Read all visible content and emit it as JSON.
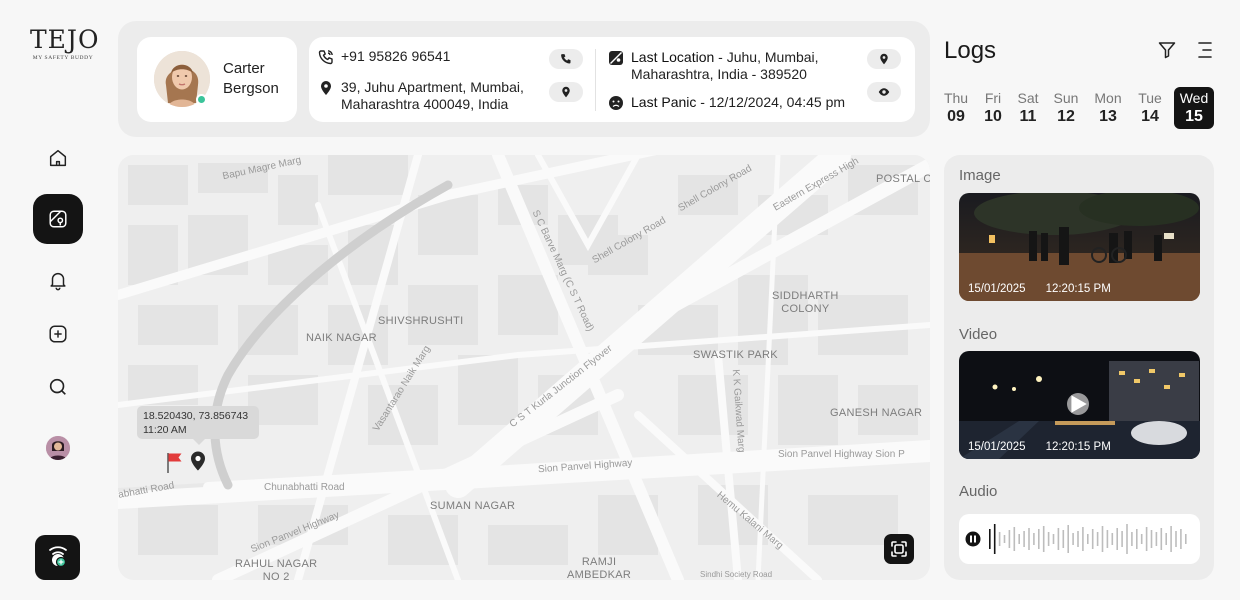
{
  "app": {
    "logo_word": "TEJO",
    "logo_tagline": "MY SAFETY BUDDY"
  },
  "sidebar": {
    "items": [
      {
        "name": "home",
        "icon": "home-icon",
        "active": false
      },
      {
        "name": "map",
        "icon": "map-icon",
        "active": true
      },
      {
        "name": "notifications",
        "icon": "bell-icon",
        "active": false
      },
      {
        "name": "add",
        "icon": "plus-square-icon",
        "active": false
      },
      {
        "name": "search",
        "icon": "search-icon",
        "active": false
      }
    ]
  },
  "profile": {
    "first_name": "Carter",
    "last_name": "Bergson",
    "status": "online"
  },
  "info": {
    "phone": "+91 95826 96541",
    "address_line1": "39, Juhu Apartment, Mumbai,",
    "address_line2": "Maharashtra 400049, India",
    "last_location_label": "Last Location",
    "last_location_line1": " - Juhu, Mumbai,",
    "last_location_line2": "Maharashtra, India - 389520",
    "last_panic_label": "Last Panic",
    "last_panic_value": " - 12/12/2024, 04:45 pm"
  },
  "map": {
    "tooltip_coords": "18.520430, 73.856743",
    "tooltip_time": "11:20 AM",
    "areas": {
      "naik_nagar": "NAIK NAGAR",
      "shivshrushti": "SHIVSHRUSHTI",
      "siddharth_1": "SIDDHARTH",
      "siddharth_2": "COLONY",
      "swastik_park": "SWASTIK PARK",
      "ganesh_nagar": "GANESH NAGAR",
      "suman_nagar": "SUMAN NAGAR",
      "rahul_nagar_1": "RAHUL NAGAR",
      "rahul_nagar_2": "NO 2",
      "ramji_1": "RAMJI",
      "ramji_2": "AMBEDKAR",
      "postal": "POSTAL C"
    },
    "roads": {
      "bapu": "Bapu Magre Marg",
      "shell_1": "Shell Colony Road",
      "shell_2": "Shell Colony Road",
      "eastern": "Eastern Express High",
      "sc_barve": "S C Barve Marg (C S T Road)",
      "cst_flyover": "C S T Kurla Junction Flyover",
      "vasantrao": "Vasantarao Naik Marg",
      "gaikwad": "K K Gaikwad Marg",
      "sion_panvel_1": "Sion Panvel Highway",
      "sion_panvel_2": "Sion Panvel Highway Sion P",
      "sion_panvel_3": "Sion Panvel Highway",
      "chunabhatti": "Chunabhatti Road",
      "bhatti": "abhatti Road",
      "hemu": "Hemu Kalani Marg",
      "sindhi": "Sindhi Society Road"
    }
  },
  "logs": {
    "title": "Logs",
    "days": [
      {
        "name": "Thu",
        "date": "09",
        "selected": false
      },
      {
        "name": "Fri",
        "date": "10",
        "selected": false
      },
      {
        "name": "Sat",
        "date": "11",
        "selected": false
      },
      {
        "name": "Sun",
        "date": "12",
        "selected": false
      },
      {
        "name": "Mon",
        "date": "13",
        "selected": false
      },
      {
        "name": "Tue",
        "date": "14",
        "selected": false
      },
      {
        "name": "Wed",
        "date": "15",
        "selected": true
      }
    ],
    "image_title": "Image",
    "image_date": "15/01/2025",
    "image_time": "12:20:15 PM",
    "video_title": "Video",
    "video_date": "15/01/2025",
    "video_time": "12:20:15 PM",
    "audio_title": "Audio"
  },
  "colors": {
    "accent_dark": "#141414",
    "online": "#3bc49a",
    "panel": "#ececec",
    "flag": "#e23b3b"
  }
}
